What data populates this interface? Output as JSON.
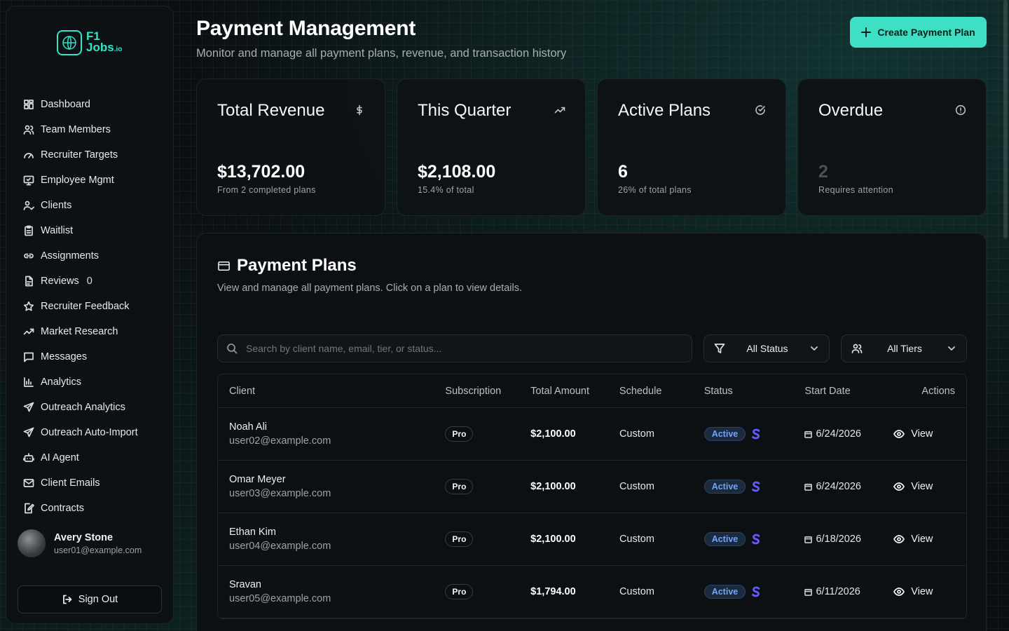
{
  "brand": {
    "line1": "F1",
    "line2": "Jobs",
    "suffix": ".io"
  },
  "sidebar": {
    "items": [
      {
        "label": "Dashboard",
        "icon": "dashboard-icon"
      },
      {
        "label": "Team Members",
        "icon": "users-icon"
      },
      {
        "label": "Recruiter Targets",
        "icon": "gauge-icon"
      },
      {
        "label": "Employee Mgmt",
        "icon": "monitor-icon"
      },
      {
        "label": "Clients",
        "icon": "user-check-icon"
      },
      {
        "label": "Waitlist",
        "icon": "clipboard-icon"
      },
      {
        "label": "Assignments",
        "icon": "link-icon"
      },
      {
        "label": "Reviews",
        "icon": "file-icon",
        "count": "0"
      },
      {
        "label": "Recruiter Feedback",
        "icon": "star-icon"
      },
      {
        "label": "Market Research",
        "icon": "trending-icon"
      },
      {
        "label": "Messages",
        "icon": "message-icon"
      },
      {
        "label": "Analytics",
        "icon": "bar-chart-icon"
      },
      {
        "label": "Outreach Analytics",
        "icon": "send-icon"
      },
      {
        "label": "Outreach Auto-Import",
        "icon": "send-icon"
      },
      {
        "label": "AI Agent",
        "icon": "bot-icon"
      },
      {
        "label": "Client Emails",
        "icon": "mail-icon"
      },
      {
        "label": "Contracts",
        "icon": "file-edit-icon"
      }
    ],
    "user": {
      "name": "Avery Stone",
      "email": "user01@example.com"
    },
    "signout_label": "Sign Out"
  },
  "header": {
    "title": "Payment Management",
    "subtitle": "Monitor and manage all payment plans, revenue, and transaction history",
    "create_label": "Create Payment Plan"
  },
  "stats": [
    {
      "title": "Total Revenue",
      "value": "$13,702.00",
      "sub": "From 2 completed plans",
      "icon": "dollar-icon"
    },
    {
      "title": "This Quarter",
      "value": "$2,108.00",
      "sub": "15.4% of total",
      "icon": "trending-up-icon"
    },
    {
      "title": "Active Plans",
      "value": "6",
      "sub": "26% of total plans",
      "icon": "check-circle-icon"
    },
    {
      "title": "Overdue",
      "value": "2",
      "sub": "Requires attention",
      "icon": "alert-circle-icon"
    }
  ],
  "plans": {
    "title": "Payment Plans",
    "subtitle": "View and manage all payment plans. Click on a plan to view details.",
    "search_placeholder": "Search by client name, email, tier, or status...",
    "status_filter": "All Status",
    "tier_filter": "All Tiers",
    "columns": [
      "Client",
      "Subscription",
      "Total Amount",
      "Schedule",
      "Status",
      "Start Date",
      "Actions"
    ],
    "rows": [
      {
        "name": "Noah Ali",
        "email": "user02@example.com",
        "tier": "Pro",
        "amount": "$2,100.00",
        "schedule": "Custom",
        "status": "Active",
        "date": "6/24/2026",
        "action": "View"
      },
      {
        "name": "Omar Meyer",
        "email": "user03@example.com",
        "tier": "Pro",
        "amount": "$2,100.00",
        "schedule": "Custom",
        "status": "Active",
        "date": "6/24/2026",
        "action": "View"
      },
      {
        "name": "Ethan Kim",
        "email": "user04@example.com",
        "tier": "Pro",
        "amount": "$2,100.00",
        "schedule": "Custom",
        "status": "Active",
        "date": "6/18/2026",
        "action": "View"
      },
      {
        "name": "Sravan",
        "email": "user05@example.com",
        "tier": "Pro",
        "amount": "$1,794.00",
        "schedule": "Custom",
        "status": "Active",
        "date": "6/11/2026",
        "action": "View"
      }
    ]
  },
  "colors": {
    "accent": "#3ee0c5",
    "status_active": "#6fa5ff",
    "stripe": "#635bff"
  }
}
